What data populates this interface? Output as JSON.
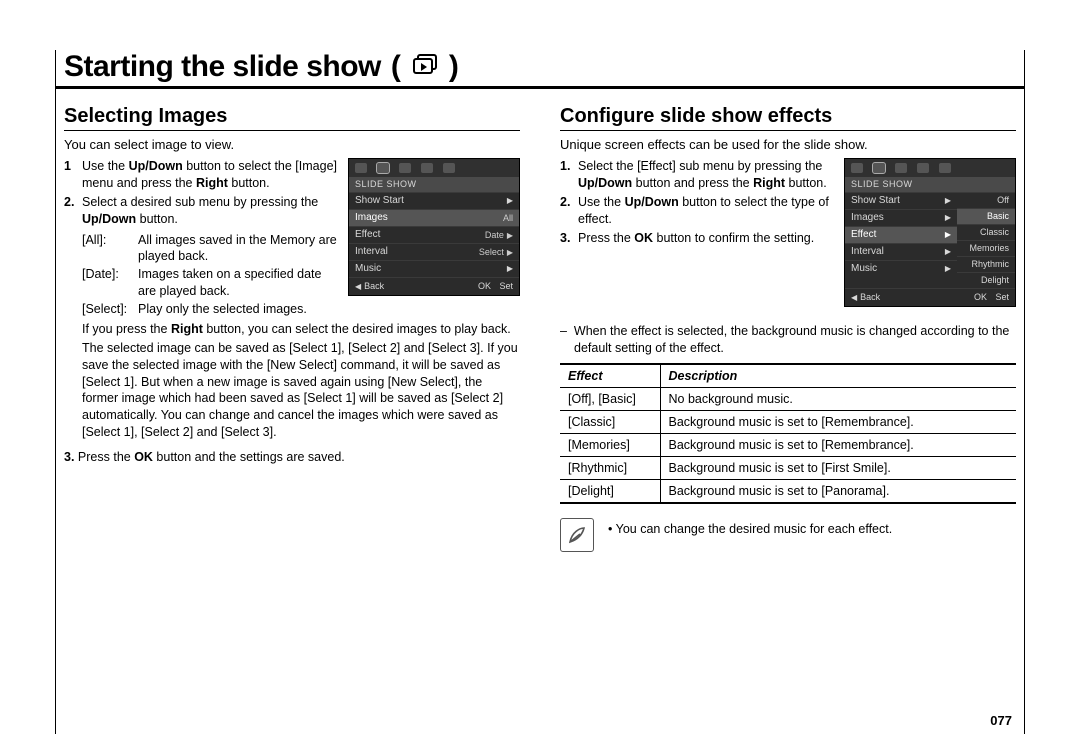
{
  "page_title": "Starting the slide show",
  "page_number": "077",
  "left": {
    "heading": "Selecting Images",
    "lede": "You can select image to view.",
    "step1_num": "1",
    "step1_a": "Use the ",
    "step1_b": "Up/Down",
    "step1_c": " button to select the [Image] menu and press the ",
    "step1_d": "Right",
    "step1_e": " button.",
    "step2_num": "2.",
    "step2_a": "Select a desired sub menu by pressing the ",
    "step2_b": "Up/Down",
    "step2_c": " button.",
    "dl_all_term": "[All]:",
    "dl_all_def": "All images saved in the Memory are played back.",
    "dl_date_term": "[Date]:",
    "dl_date_def": "Images taken on a specified date are played back.",
    "dl_select_term": "[Select]:",
    "dl_select_def": "Play only the selected images.",
    "para_a": "If you press the ",
    "para_b": "Right",
    "para_c": " button, you can select the desired images to play back.",
    "para2": "The selected image can be saved as [Select 1], [Select 2] and [Select 3]. If you save the selected image with the [New Select] command, it will be saved as [Select 1]. But when a new image is saved again using [New Select], the former image which had been saved as [Select 1] will be saved as [Select 2] automatically. You can change and cancel the images which were saved as [Select 1], [Select 2] and [Select 3].",
    "step3_num": "3.",
    "step3_a": "Press the ",
    "step3_b": "OK",
    "step3_c": " button and the settings are saved.",
    "lcd": {
      "header": "SLIDE SHOW",
      "rows": [
        {
          "label": "Show Start",
          "value": "",
          "tri": true
        },
        {
          "label": "Images",
          "value": "All",
          "tri": true,
          "sel": true
        },
        {
          "label": "Effect",
          "value": "Date",
          "tri": true
        },
        {
          "label": "Interval",
          "value": "Select",
          "tri": true
        },
        {
          "label": "Music",
          "value": "",
          "tri": true
        }
      ],
      "back": "Back",
      "ok": "OK",
      "set": "Set"
    }
  },
  "right": {
    "heading": "Configure slide show effects",
    "lede": "Unique screen effects can be used for the slide show.",
    "step1_num": "1.",
    "step1_a": "Select the [Effect] sub menu by pressing the ",
    "step1_b": "Up/Down",
    "step1_c": " button and press the ",
    "step1_d": "Right",
    "step1_e": " button.",
    "step2_num": "2.",
    "step2_a": "Use the ",
    "step2_b": "Up/Down",
    "step2_c": " button to select the type of effect.",
    "step3_num": "3.",
    "step3_a": "Press the ",
    "step3_b": "OK",
    "step3_c": " button to confirm the setting.",
    "dash_note": "When the effect is selected, the background music is changed according to the default setting of the effect.",
    "table": {
      "h1": "Effect",
      "h2": "Description",
      "rows": [
        {
          "e": "[Off], [Basic]",
          "d": "No background music."
        },
        {
          "e": "[Classic]",
          "d": "Background music is set to [Remembrance]."
        },
        {
          "e": "[Memories]",
          "d": "Background music is set to [Remembrance]."
        },
        {
          "e": "[Rhythmic]",
          "d": "Background music is set to [First Smile]."
        },
        {
          "e": "[Delight]",
          "d": "Background music is set to [Panorama]."
        }
      ]
    },
    "note": "You can change the desired music for each effect.",
    "lcd": {
      "header": "SLIDE SHOW",
      "rows_left": [
        {
          "label": "Show Start"
        },
        {
          "label": "Images"
        },
        {
          "label": "Effect",
          "sel": true
        },
        {
          "label": "Interval"
        },
        {
          "label": "Music"
        }
      ],
      "rows_right": [
        {
          "v": "Off"
        },
        {
          "v": "Basic",
          "sel": true
        },
        {
          "v": "Classic"
        },
        {
          "v": "Memories"
        },
        {
          "v": "Rhythmic"
        },
        {
          "v": "Delight"
        }
      ],
      "back": "Back",
      "ok": "OK",
      "set": "Set"
    }
  }
}
